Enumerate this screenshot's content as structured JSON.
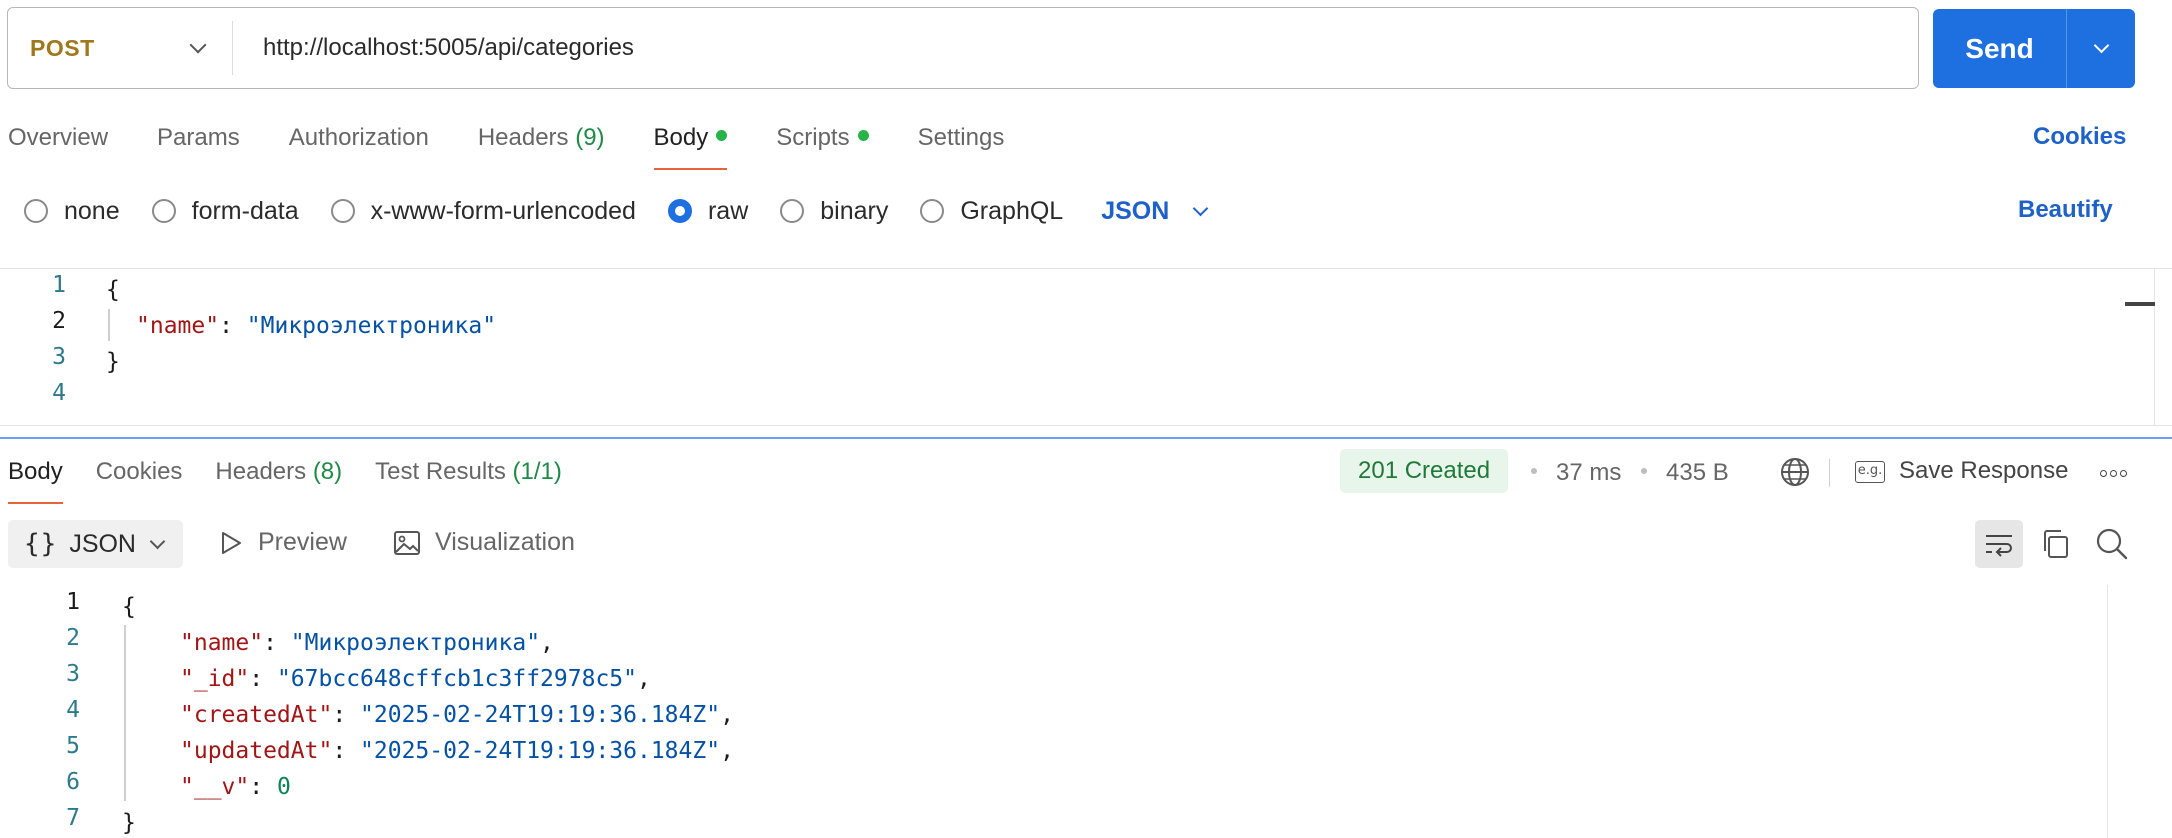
{
  "request": {
    "method": "POST",
    "url": "http://localhost:5005/api/categories",
    "send_label": "Send"
  },
  "request_tabs": [
    {
      "label": "Overview"
    },
    {
      "label": "Params"
    },
    {
      "label": "Authorization"
    },
    {
      "label": "Headers",
      "count": "(9)"
    },
    {
      "label": "Body",
      "active": true,
      "dot": true
    },
    {
      "label": "Scripts",
      "dot": true
    },
    {
      "label": "Settings"
    }
  ],
  "cookies_link": "Cookies",
  "body_types": {
    "options": [
      "none",
      "form-data",
      "x-www-form-urlencoded",
      "raw",
      "binary",
      "GraphQL"
    ],
    "selected": "raw",
    "format": "JSON"
  },
  "beautify_label": "Beautify",
  "request_body": {
    "line_numbers": [
      "1",
      "2",
      "3",
      "4"
    ],
    "brace_open": "{",
    "key": "\"name\"",
    "colon": ": ",
    "value": "\"Микроэлектроника\"",
    "brace_close": "}"
  },
  "response_tabs": [
    {
      "label": "Body",
      "active": true
    },
    {
      "label": "Cookies"
    },
    {
      "label": "Headers",
      "count": "(8)"
    },
    {
      "label": "Test Results",
      "count": "(1/1)"
    }
  ],
  "response_meta": {
    "status": "201 Created",
    "time": "37 ms",
    "size": "435 B",
    "save_label": "Save Response",
    "eg_label": "e.g."
  },
  "response_view": {
    "format": "JSON",
    "preview": "Preview",
    "visualization": "Visualization"
  },
  "response_body": {
    "line_numbers": [
      "1",
      "2",
      "3",
      "4",
      "5",
      "6",
      "7"
    ],
    "brace_open": "{",
    "brace_close": "}",
    "fields": [
      {
        "key": "\"name\"",
        "value": "\"Микроэлектроника\"",
        "comma": ","
      },
      {
        "key": "\"_id\"",
        "value": "\"67bcc648cffcb1c3ff2978c5\"",
        "comma": ","
      },
      {
        "key": "\"createdAt\"",
        "value": "\"2025-02-24T19:19:36.184Z\"",
        "comma": ","
      },
      {
        "key": "\"updatedAt\"",
        "value": "\"2025-02-24T19:19:36.184Z\"",
        "comma": ","
      },
      {
        "key": "\"__v\"",
        "value": "0",
        "comma": "",
        "numeric": true
      }
    ]
  },
  "colors": {
    "accent": "#1e6fe0",
    "method": "#a0771a",
    "status_ok": "#1f7a3a",
    "active_tab_underline": "#e8633b"
  }
}
